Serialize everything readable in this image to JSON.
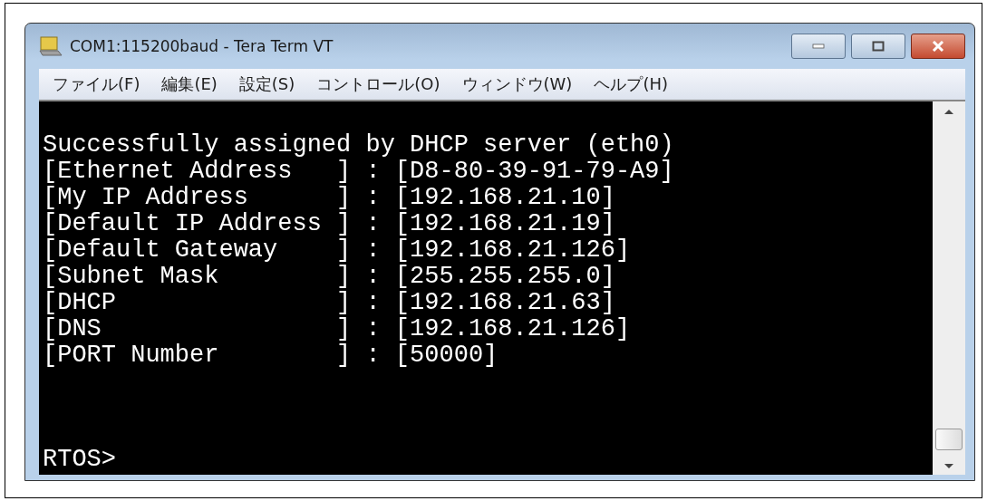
{
  "window": {
    "title": "COM1:115200baud - Tera Term VT"
  },
  "menu": [
    "ファイル(F)",
    "編集(E)",
    "設定(S)",
    "コントロール(O)",
    "ウィンドウ(W)",
    "ヘルプ(H)"
  ],
  "terminal": {
    "lines": [
      "Successfully assigned by DHCP server (eth0)",
      "[Ethernet Address   ] : [D8-80-39-91-79-A9]",
      "[My IP Address      ] : [192.168.21.10]",
      "[Default IP Address ] : [192.168.21.19]",
      "[Default Gateway    ] : [192.168.21.126]",
      "[Subnet Mask        ] : [255.255.255.0]",
      "[DHCP               ] : [192.168.21.63]",
      "[DNS                ] : [192.168.21.126]",
      "[PORT Number        ] : [50000]"
    ],
    "prompt": "RTOS>"
  }
}
